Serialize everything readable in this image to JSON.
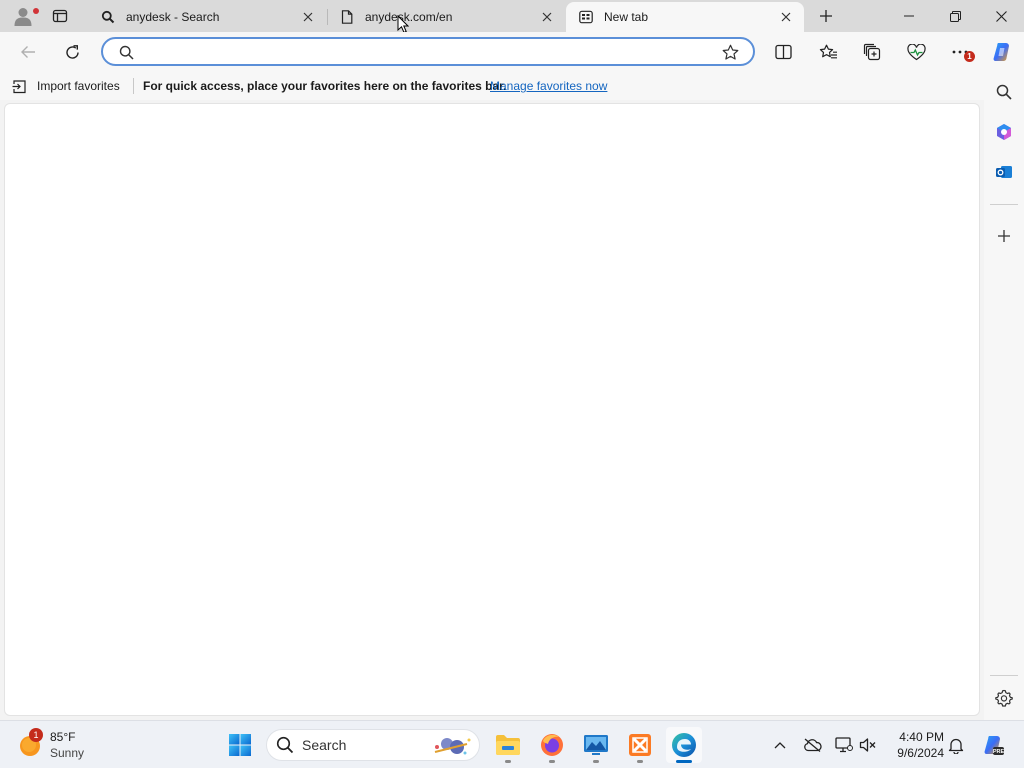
{
  "browser": {
    "tabs": [
      {
        "title": "anydesk - Search",
        "icon": "search-icon",
        "active": false
      },
      {
        "title": "anydesk.com/en",
        "icon": "page-icon",
        "active": false
      },
      {
        "title": "New tab",
        "icon": "newtab-icon",
        "active": true
      }
    ],
    "address": {
      "value": "",
      "placeholder": ""
    },
    "favorites_bar": {
      "import_label": "Import favorites",
      "message": "For quick access, place your favorites here on the favorites bar.",
      "manage_link": "Manage favorites now"
    },
    "extensions_badge": "1",
    "accent_color": "#5b8fd8"
  },
  "taskbar": {
    "weather": {
      "temp": "85°F",
      "condition": "Sunny",
      "badge": "1"
    },
    "search_label": "Search",
    "apps": [
      "file-explorer-icon",
      "firefox-icon",
      "remote-desktop-icon",
      "xampp-icon",
      "edge-icon"
    ],
    "clock": {
      "time": "4:40 PM",
      "date": "9/6/2024"
    }
  }
}
